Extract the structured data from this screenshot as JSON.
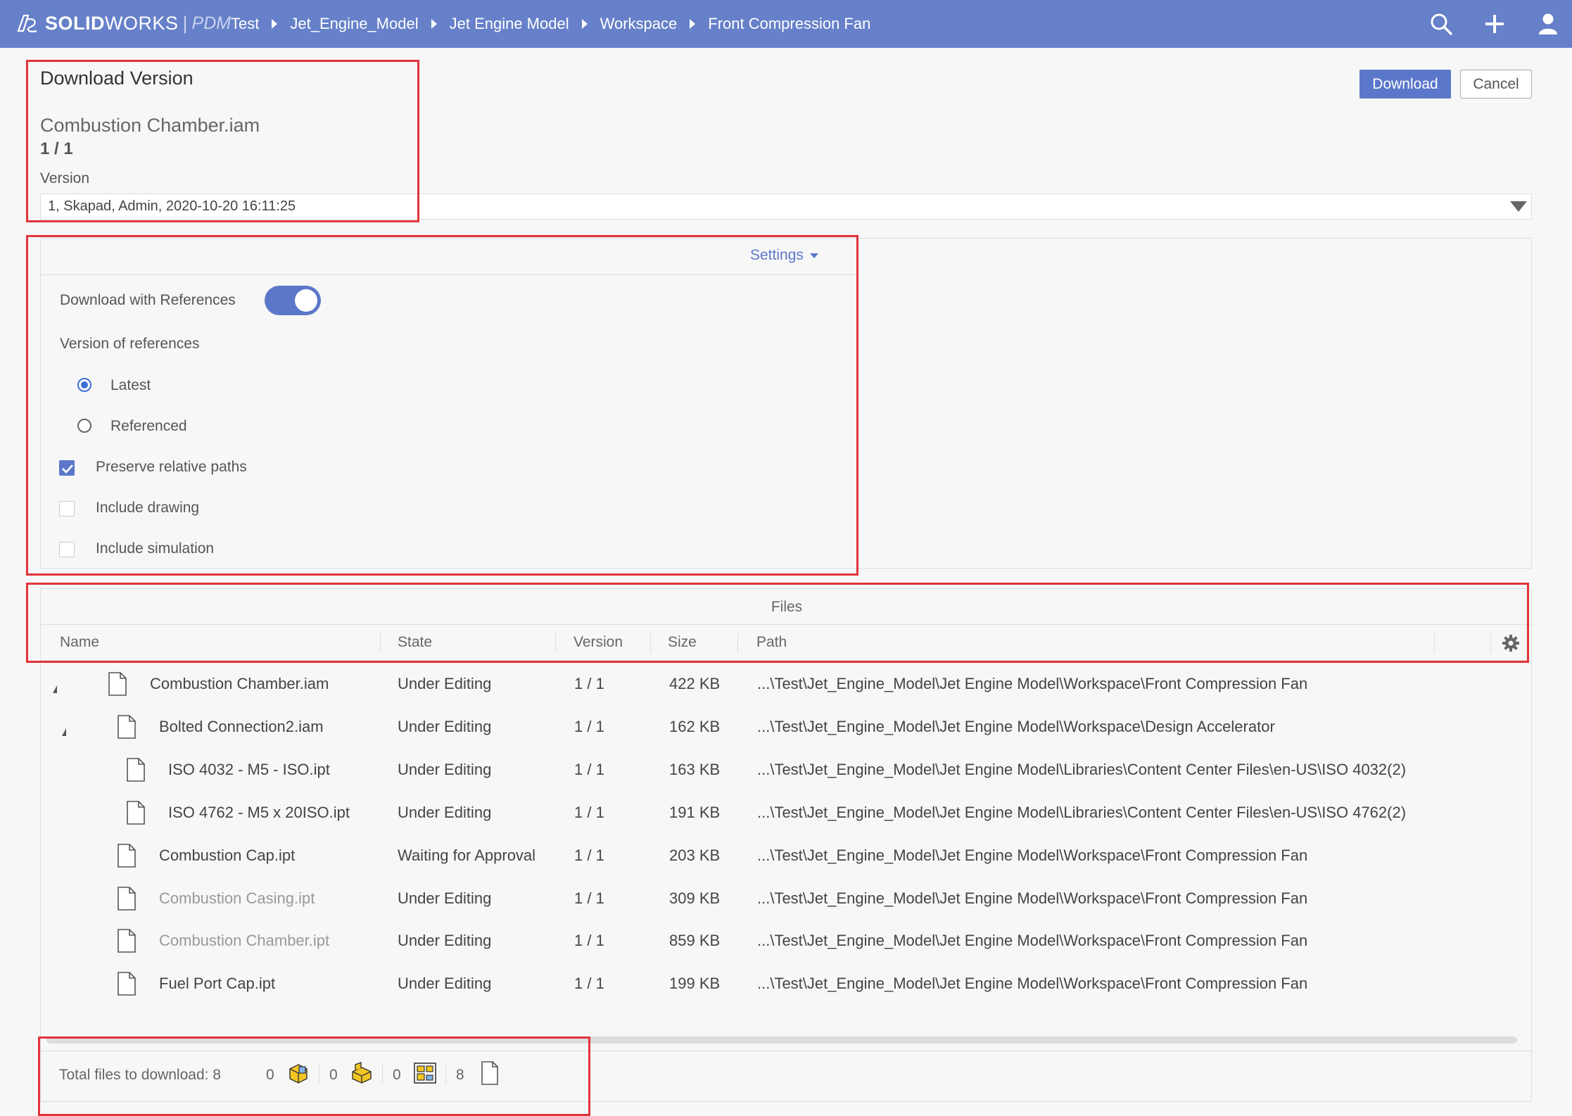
{
  "app": {
    "brand_bold": "SOLID",
    "brand_light": "WORKS",
    "brand_sep": "|",
    "brand_product": "PDM"
  },
  "breadcrumbs": [
    "Test",
    "Jet_Engine_Model",
    "Jet Engine Model",
    "Workspace",
    "Front Compression Fan"
  ],
  "top_icons": [
    "search-icon",
    "plus-icon",
    "user-icon"
  ],
  "header": {
    "title": "Download Version",
    "file_name": "Combustion Chamber.iam",
    "file_version": "1 / 1",
    "version_label": "Version",
    "version_value": "1, Skapad, Admin, 2020-10-20 16:11:25"
  },
  "buttons": {
    "download": "Download",
    "cancel": "Cancel"
  },
  "settings": {
    "toggle_label": "Settings",
    "download_with_references": {
      "label": "Download with References",
      "on": true
    },
    "version_of_references_label": "Version of references",
    "radio_latest": {
      "label": "Latest",
      "selected": true
    },
    "radio_referenced": {
      "label": "Referenced",
      "selected": false
    },
    "preserve_relative_paths": {
      "label": "Preserve relative paths",
      "checked": true
    },
    "include_drawing": {
      "label": "Include drawing",
      "checked": false
    },
    "include_simulation": {
      "label": "Include simulation",
      "checked": false
    }
  },
  "files": {
    "title": "Files",
    "columns": [
      "Name",
      "State",
      "Version",
      "Size",
      "Path"
    ],
    "rows": [
      {
        "name": "Combustion Chamber.iam",
        "state": "Under Editing",
        "version": "1 / 1",
        "size": "422 KB",
        "path": "...\\Test\\Jet_Engine_Model\\Jet Engine Model\\Workspace\\Front Compression Fan",
        "depth": 0,
        "expandable": true,
        "dim": false
      },
      {
        "name": "Bolted Connection2.iam",
        "state": "Under Editing",
        "version": "1 / 1",
        "size": "162 KB",
        "path": "...\\Test\\Jet_Engine_Model\\Jet Engine Model\\Workspace\\Design Accelerator",
        "depth": 1,
        "expandable": true,
        "dim": false
      },
      {
        "name": "ISO 4032 - M5 - ISO.ipt",
        "state": "Under Editing",
        "version": "1 / 1",
        "size": "163 KB",
        "path": "...\\Test\\Jet_Engine_Model\\Jet Engine Model\\Libraries\\Content Center Files\\en-US\\ISO 4032(2)",
        "depth": 2,
        "expandable": false,
        "dim": false
      },
      {
        "name": "ISO 4762 - M5 x 20ISO.ipt",
        "state": "Under Editing",
        "version": "1 / 1",
        "size": "191 KB",
        "path": "...\\Test\\Jet_Engine_Model\\Jet Engine Model\\Libraries\\Content Center Files\\en-US\\ISO 4762(2)",
        "depth": 2,
        "expandable": false,
        "dim": false
      },
      {
        "name": "Combustion Cap.ipt",
        "state": "Waiting for Approval",
        "version": "1 / 1",
        "size": "203 KB",
        "path": "...\\Test\\Jet_Engine_Model\\Jet Engine Model\\Workspace\\Front Compression Fan",
        "depth": 1,
        "expandable": false,
        "dim": false
      },
      {
        "name": "Combustion Casing.ipt",
        "state": "Under Editing",
        "version": "1 / 1",
        "size": "309 KB",
        "path": "...\\Test\\Jet_Engine_Model\\Jet Engine Model\\Workspace\\Front Compression Fan",
        "depth": 1,
        "expandable": false,
        "dim": true
      },
      {
        "name": "Combustion Chamber.ipt",
        "state": "Under Editing",
        "version": "1 / 1",
        "size": "859 KB",
        "path": "...\\Test\\Jet_Engine_Model\\Jet Engine Model\\Workspace\\Front Compression Fan",
        "depth": 1,
        "expandable": false,
        "dim": true
      },
      {
        "name": "Fuel Port Cap.ipt",
        "state": "Under Editing",
        "version": "1 / 1",
        "size": "199 KB",
        "path": "...\\Test\\Jet_Engine_Model\\Jet Engine Model\\Workspace\\Front Compression Fan",
        "depth": 1,
        "expandable": false,
        "dim": false
      }
    ]
  },
  "footer": {
    "total_label": "Total files to download: 8",
    "counts": [
      {
        "value": "0",
        "icon": "assembly-icon"
      },
      {
        "value": "0",
        "icon": "part-icon"
      },
      {
        "value": "0",
        "icon": "drawing-icon"
      },
      {
        "value": "8",
        "icon": "document-icon"
      }
    ]
  },
  "colors": {
    "topbar": "#6680c9",
    "accent": "#5b77c9",
    "highlight": "#e2343b"
  }
}
